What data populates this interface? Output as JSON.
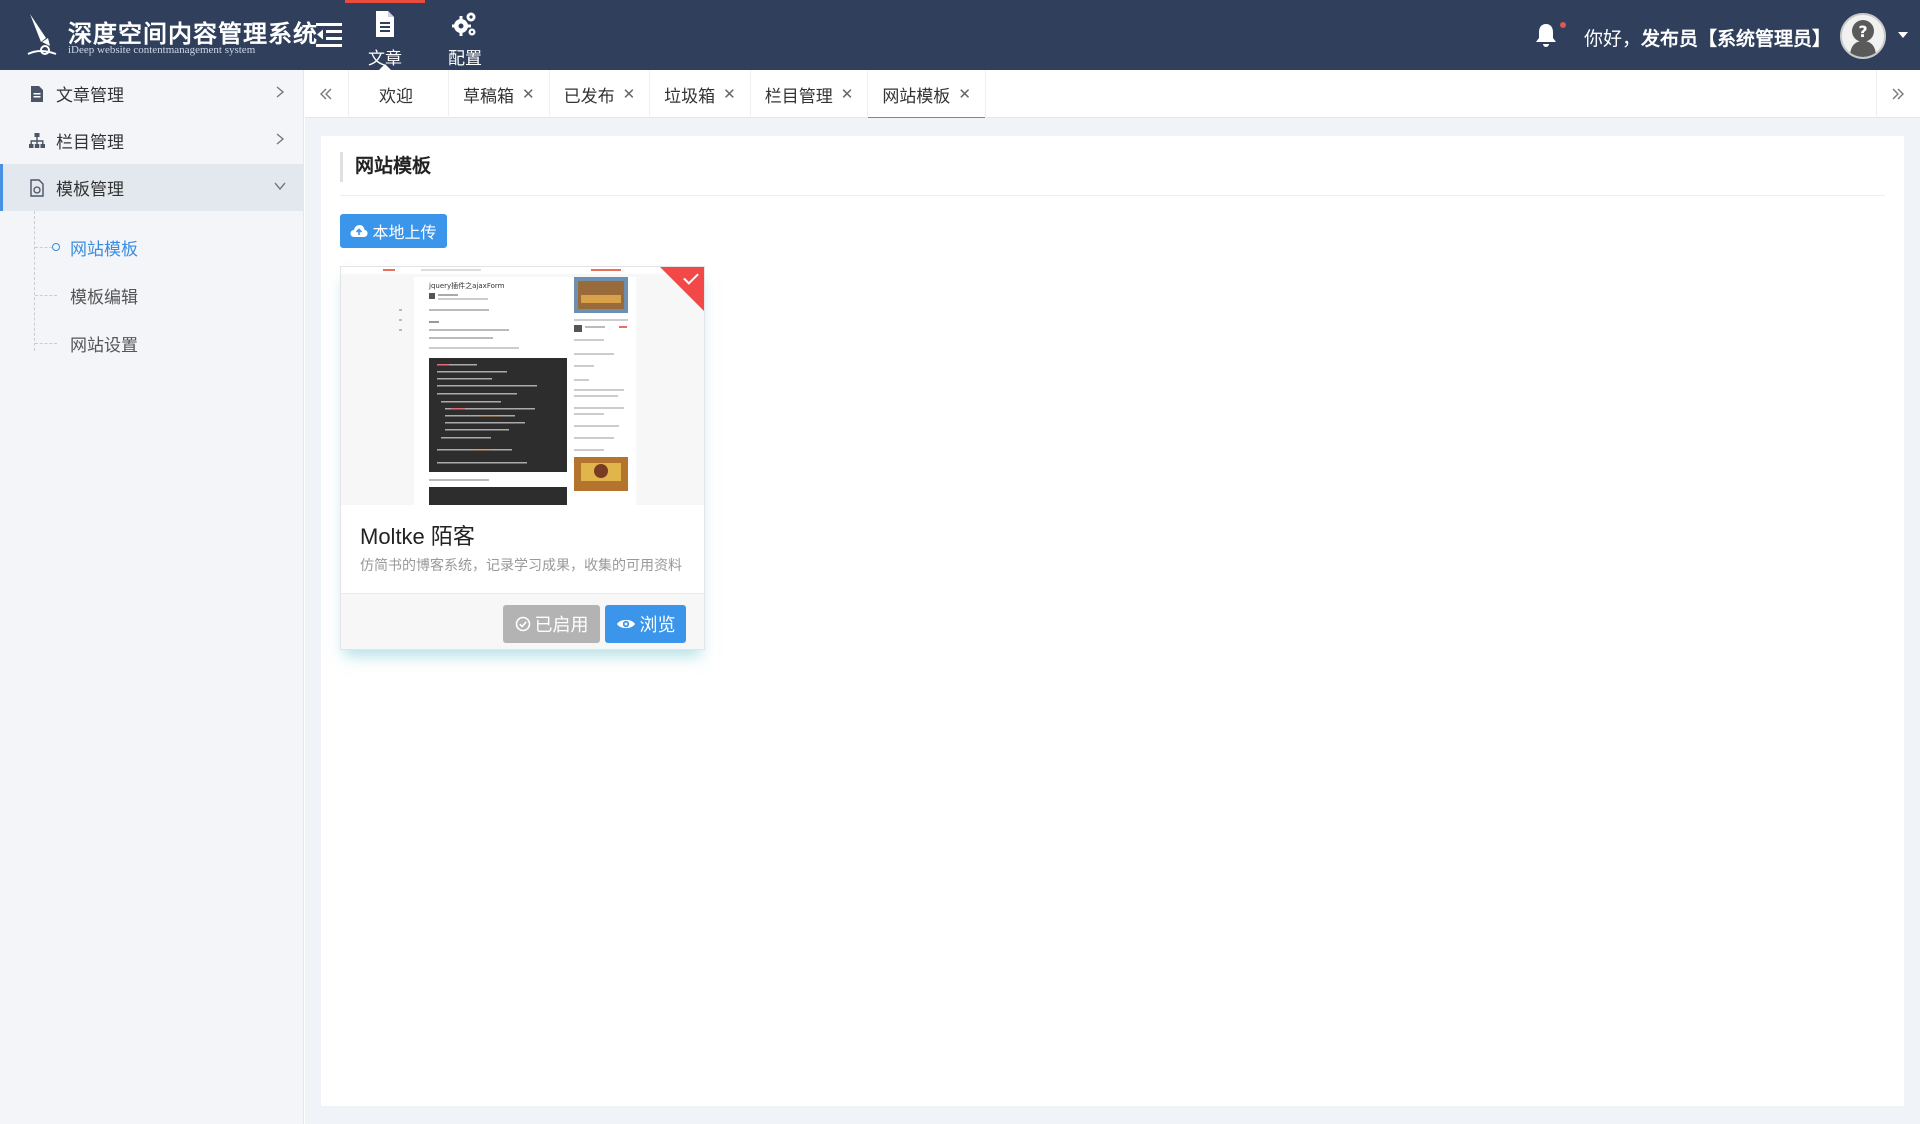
{
  "header": {
    "logo_title": "深度空间内容管理系统",
    "logo_subtitle": "iDeep website contentmanagement system",
    "nav": [
      {
        "label": "文章",
        "icon": "document-icon",
        "active": true
      },
      {
        "label": "配置",
        "icon": "gears-icon",
        "active": false
      }
    ],
    "greeting_prefix": "你好，",
    "user_name": "发布员【系统管理员】"
  },
  "sidebar": {
    "items": [
      {
        "label": "文章管理",
        "icon": "document-icon"
      },
      {
        "label": "栏目管理",
        "icon": "sitemap-icon"
      },
      {
        "label": "模板管理",
        "icon": "template-icon"
      }
    ],
    "subitems": [
      {
        "label": "网站模板",
        "active": true
      },
      {
        "label": "模板编辑",
        "active": false
      },
      {
        "label": "网站设置",
        "active": false
      }
    ]
  },
  "tabs": [
    {
      "label": "欢迎",
      "closable": false
    },
    {
      "label": "草稿箱",
      "closable": true
    },
    {
      "label": "已发布",
      "closable": true
    },
    {
      "label": "垃圾箱",
      "closable": true
    },
    {
      "label": "栏目管理",
      "closable": true
    },
    {
      "label": "网站模板",
      "closable": true,
      "active": true
    }
  ],
  "tab_close_glyph": "✕",
  "panel": {
    "title": "网站模板",
    "upload_label": "本地上传"
  },
  "template_card": {
    "name": "Moltke 陌客",
    "description": "仿简书的博客系统，记录学习成果，收集的可用资料",
    "enabled_label": "已启用",
    "preview_label": "浏览",
    "thumb_heading": "jquery插件之ajaxForm"
  },
  "colors": {
    "header_bg": "#2f3f5c",
    "accent_blue": "#3b95ea",
    "active_red": "#e84c3d",
    "disabled_gray": "#b3b3b3"
  }
}
